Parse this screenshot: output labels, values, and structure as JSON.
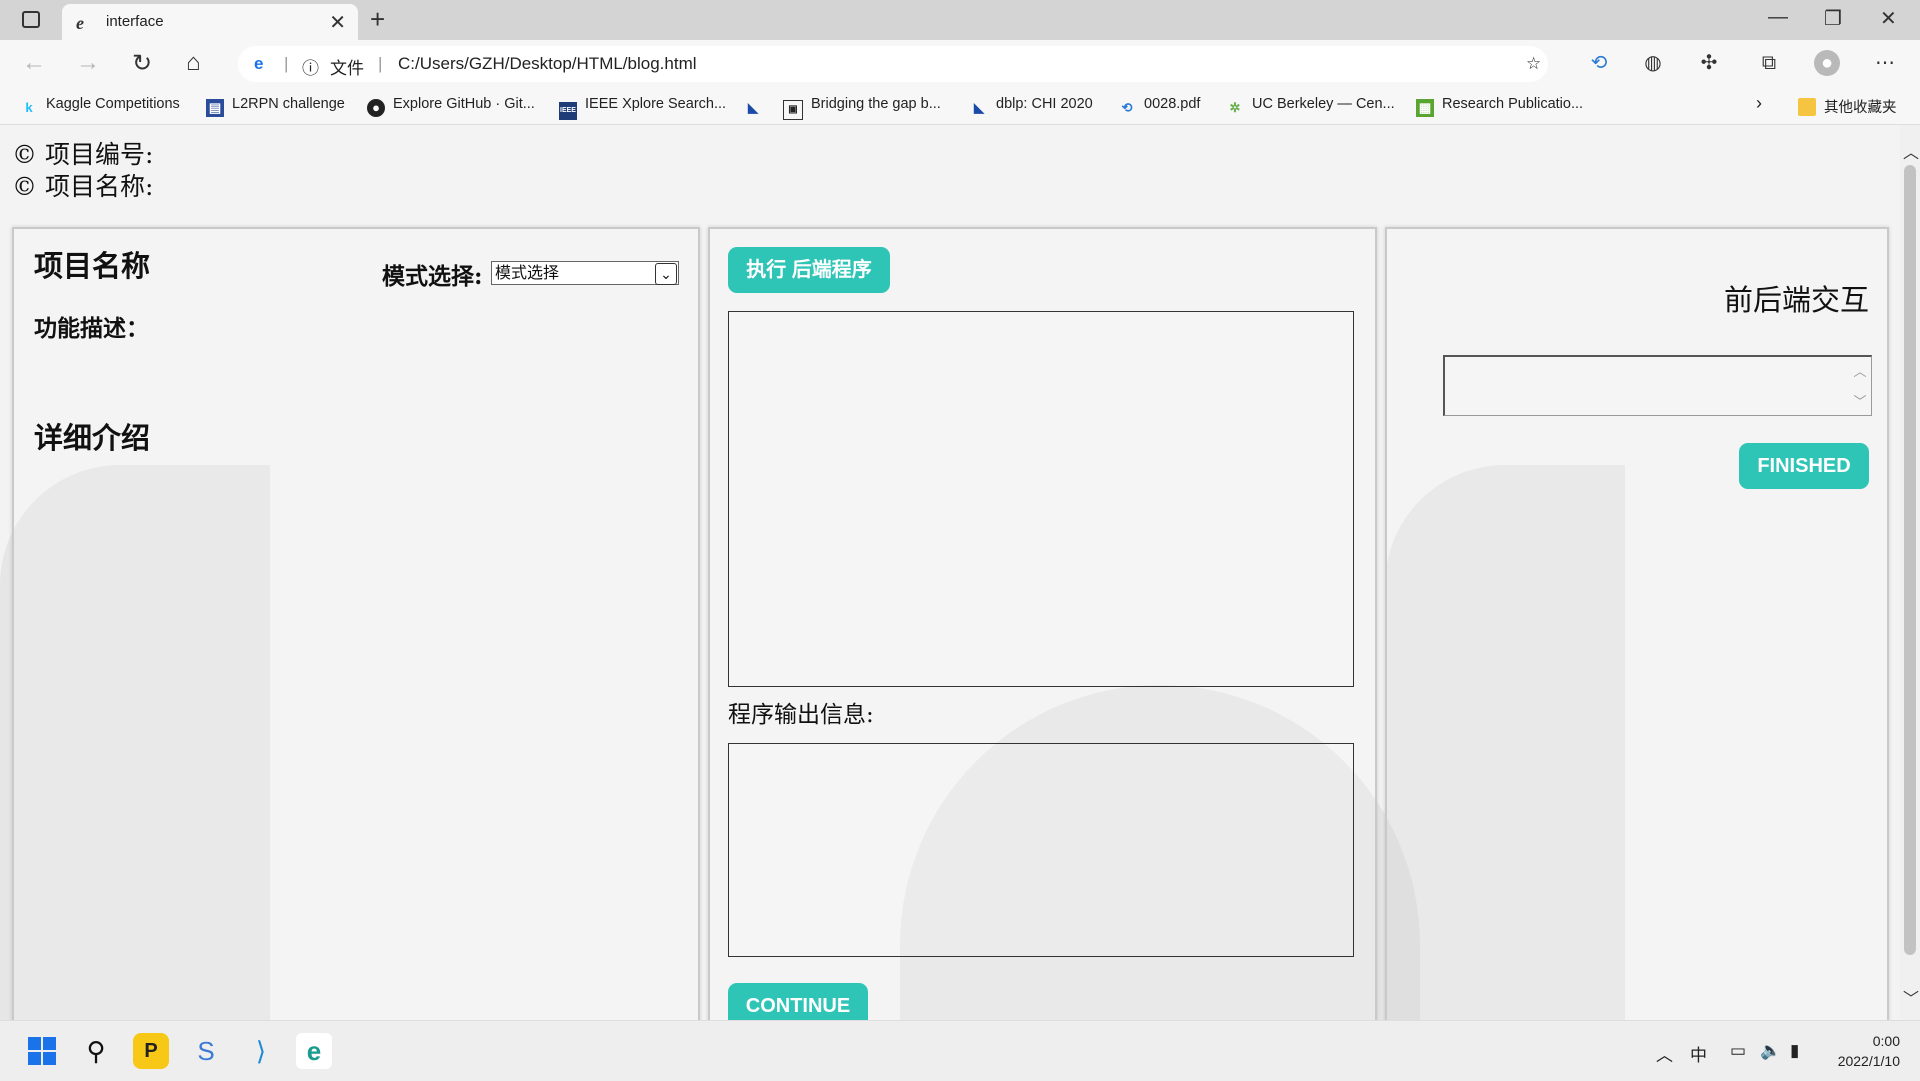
{
  "browser": {
    "tab_title": "interface",
    "new_tab": "+",
    "file_label": "文件",
    "url": "C:/Users/GZH/Desktop/HTML/blog.html",
    "bookmarks": [
      {
        "label": "Kaggle Competitions",
        "icon": "kaggle-icon"
      },
      {
        "label": "L2RPN challenge",
        "icon": "l2rpn-icon"
      },
      {
        "label": "Explore GitHub · Git...",
        "icon": "github-icon"
      },
      {
        "label": "IEEE Xplore Search...",
        "icon": "ieee-icon"
      },
      {
        "label": "",
        "icon": "dblp-icon"
      },
      {
        "label": "Bridging the gap b...",
        "icon": "page-icon"
      },
      {
        "label": "dblp: CHI 2020",
        "icon": "dblp-icon"
      },
      {
        "label": "0028.pdf",
        "icon": "sync-icon"
      },
      {
        "label": "UC Berkeley — Cen...",
        "icon": "berkeley-icon"
      },
      {
        "label": "Research Publicatio...",
        "icon": "research-icon"
      }
    ],
    "other_bookmarks": "其他收藏夹"
  },
  "page": {
    "project_number": "© 项目编号:",
    "project_name_meta": "© 项目名称:",
    "left": {
      "title": "项目名称",
      "mode_label": "模式选择:",
      "mode_value": "模式选择",
      "func_desc": "功能描述：",
      "detail": "详细介绍"
    },
    "middle": {
      "run_button": "执行 后端程序",
      "output_label": "程序输出信息:",
      "continue_button": "CONTINUE"
    },
    "right": {
      "title": "前后端交互",
      "finished_button": "FINISHED"
    }
  },
  "taskbar": {
    "ime": "中",
    "time": "0:00",
    "date": "2022/1/10"
  }
}
